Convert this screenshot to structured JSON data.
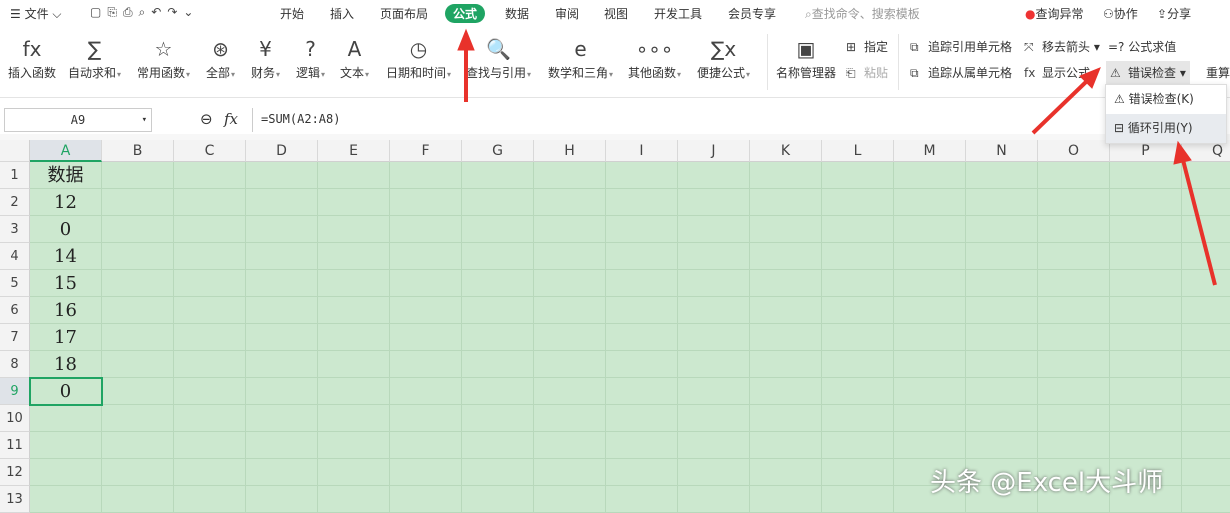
{
  "topbar": {
    "menu": "文件",
    "tabs": [
      "开始",
      "插入",
      "页面布局",
      "公式",
      "数据",
      "审阅",
      "视图",
      "开发工具",
      "会员专享"
    ],
    "active_tab": "公式",
    "search_placeholder": "查找命令、搜索模板",
    "query_errors": "查询异常",
    "collab": "协作",
    "share": "分享"
  },
  "ribbon": {
    "buttons": [
      {
        "label": "插入函数",
        "icon": "fx"
      },
      {
        "label": "自动求和",
        "icon": "∑"
      },
      {
        "label": "常用函数",
        "icon": "☆"
      },
      {
        "label": "全部",
        "icon": "⊛"
      },
      {
        "label": "财务",
        "icon": "¥"
      },
      {
        "label": "逻辑",
        "icon": "?"
      },
      {
        "label": "文本",
        "icon": "A"
      },
      {
        "label": "日期和时间",
        "icon": "◷"
      },
      {
        "label": "查找与引用",
        "icon": "🔍"
      },
      {
        "label": "数学和三角",
        "icon": "e"
      },
      {
        "label": "其他函数",
        "icon": "∘∘∘"
      },
      {
        "label": "便捷公式",
        "icon": "∑x"
      },
      {
        "label": "名称管理器",
        "icon": "▣"
      }
    ],
    "assign": "指定",
    "paste": "粘贴",
    "trace_precedents": "追踪引用单元格",
    "trace_dependents": "追踪从属单元格",
    "remove_arrows": "移去箭头",
    "show_formulas": "显示公式",
    "evaluate": "=? 公式求值",
    "error_check": "错误检查",
    "recalc": "重算"
  },
  "dropdown": {
    "items": [
      "错误检查(K)",
      "循环引用(Y)"
    ]
  },
  "formula_bar": {
    "name_box": "A9",
    "fx": "fx",
    "formula": "=SUM(A2:A8)"
  },
  "sheet": {
    "columns": [
      "A",
      "B",
      "C",
      "D",
      "E",
      "F",
      "G",
      "H",
      "I",
      "J",
      "K",
      "L",
      "M",
      "N",
      "O",
      "P",
      "Q"
    ],
    "rows": [
      "1",
      "2",
      "3",
      "4",
      "5",
      "6",
      "7",
      "8",
      "9",
      "10",
      "11",
      "12",
      "13"
    ],
    "a_values": [
      "数据",
      "12",
      "0",
      "14",
      "15",
      "16",
      "17",
      "18",
      "0"
    ],
    "selected": "A9"
  },
  "watermark": "头条 @Excel大斗师"
}
